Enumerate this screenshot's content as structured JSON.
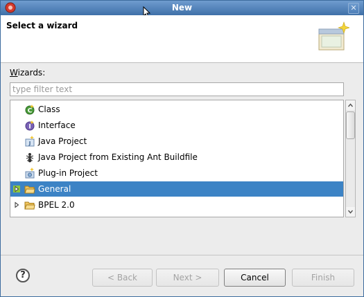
{
  "window": {
    "title": "New"
  },
  "header": {
    "heading": "Select a wizard"
  },
  "wizards": {
    "label_mnemonic": "W",
    "label_rest": "izards:",
    "filter_placeholder": "type filter text",
    "filter_value": ""
  },
  "tree": {
    "items": [
      {
        "label": "Class",
        "icon": "class-icon",
        "expandable": false,
        "selected": false
      },
      {
        "label": "Interface",
        "icon": "interface-icon",
        "expandable": false,
        "selected": false
      },
      {
        "label": "Java Project",
        "icon": "java-project-icon",
        "expandable": false,
        "selected": false
      },
      {
        "label": "Java Project from Existing Ant Buildfile",
        "icon": "ant-icon",
        "expandable": false,
        "selected": false
      },
      {
        "label": "Plug-in Project",
        "icon": "plugin-project-icon",
        "expandable": false,
        "selected": false
      },
      {
        "label": "General",
        "icon": "folder-icon",
        "expandable": true,
        "selected": true
      },
      {
        "label": "BPEL 2.0",
        "icon": "folder-icon",
        "expandable": true,
        "selected": false
      }
    ]
  },
  "buttons": {
    "help": "?",
    "back": "< Back",
    "next": "Next >",
    "cancel": "Cancel",
    "finish": "Finish"
  },
  "colors": {
    "titlebar": "#4f80b8",
    "selection": "#3c83c5",
    "disabled_text": "#a3a3a3"
  }
}
